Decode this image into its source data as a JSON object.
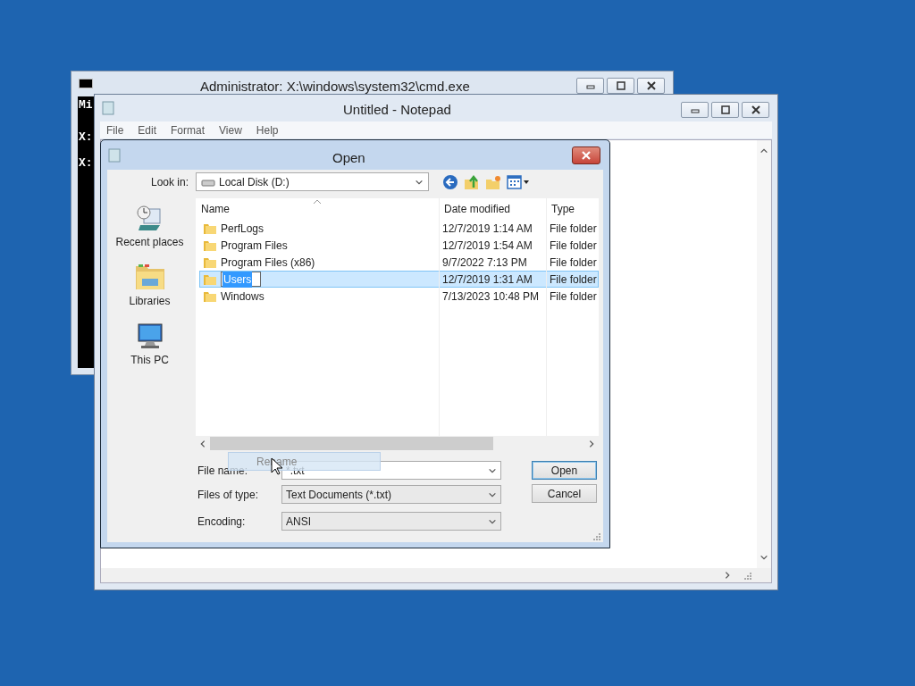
{
  "cmd_window": {
    "title": "Administrator: X:\\windows\\system32\\cmd.exe",
    "console_lines": [
      "Mi",
      "X:",
      "X:"
    ]
  },
  "notepad": {
    "title": "Untitled - Notepad",
    "menu": [
      "File",
      "Edit",
      "Format",
      "View",
      "Help"
    ]
  },
  "open_dialog": {
    "title": "Open",
    "look_in": {
      "label": "Look in:",
      "value": "Local Disk (D:)"
    },
    "places": [
      {
        "label": "Recent places",
        "kind": "recent"
      },
      {
        "label": "Libraries",
        "kind": "libraries"
      },
      {
        "label": "This PC",
        "kind": "pc"
      }
    ],
    "columns": [
      "Name",
      "Date modified",
      "Type"
    ],
    "rows": [
      {
        "name": "PerfLogs",
        "date": "12/7/2019 1:14 AM",
        "type": "File folder",
        "selected": false,
        "renaming": false
      },
      {
        "name": "Program Files",
        "date": "12/7/2019 1:54 AM",
        "type": "File folder",
        "selected": false,
        "renaming": false
      },
      {
        "name": "Program Files (x86)",
        "date": "9/7/2022 7:13 PM",
        "type": "File folder",
        "selected": false,
        "renaming": false
      },
      {
        "name": "Users",
        "date": "12/7/2019 1:31 AM",
        "type": "File folder",
        "selected": true,
        "renaming": true
      },
      {
        "name": "Windows",
        "date": "7/13/2023 10:48 PM",
        "type": "File folder",
        "selected": false,
        "renaming": false
      }
    ],
    "fields": [
      {
        "label": "File name:",
        "value": "*.txt"
      },
      {
        "label": "Files of type:",
        "value": "Text Documents (*.txt)"
      },
      {
        "label": "Encoding:",
        "value": "ANSI"
      }
    ],
    "buttons": [
      {
        "label": "Open",
        "default": true
      },
      {
        "label": "Cancel",
        "default": false
      }
    ],
    "drag_ghost": {
      "label": "Rename"
    }
  }
}
